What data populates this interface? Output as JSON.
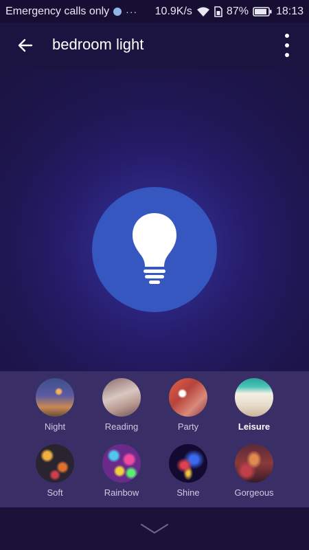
{
  "status": {
    "carrier": "Emergency calls only",
    "dots": "···",
    "speed": "10.9K/s",
    "battery": "87%",
    "time": "18:13"
  },
  "appbar": {
    "title": "bedroom light"
  },
  "scenes": [
    {
      "label": "Night"
    },
    {
      "label": "Reading"
    },
    {
      "label": "Party"
    },
    {
      "label": "Leisure",
      "selected": true
    },
    {
      "label": "Soft"
    },
    {
      "label": "Rainbow"
    },
    {
      "label": "Shine"
    },
    {
      "label": "Gorgeous"
    }
  ]
}
